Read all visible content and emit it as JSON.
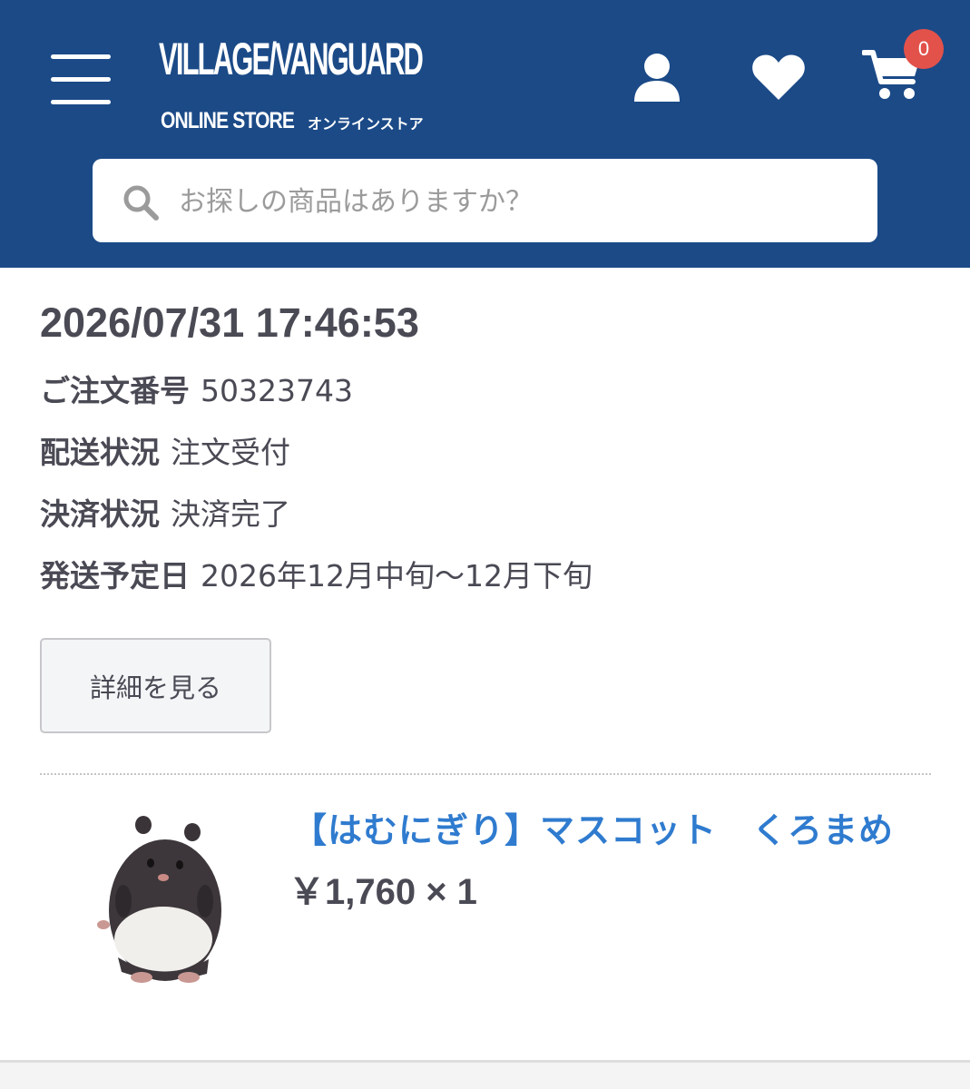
{
  "header": {
    "logo_main": "VILLAGE/VANGUARD",
    "logo_sub_en": "ONLINE STORE",
    "logo_sub_jp": "オンラインストア",
    "cart_count": "0",
    "colors": {
      "header_bg": "#1b4a87",
      "badge": "#e2524a"
    }
  },
  "search": {
    "placeholder": "お探しの商品はありますか？"
  },
  "order": {
    "datetime": "2026/07/31 17:46:53",
    "number_label": "ご注文番号",
    "number_value": "50323743",
    "shipping_status_label": "配送状況",
    "shipping_status_value": "注文受付",
    "payment_status_label": "決済状況",
    "payment_status_value": "決済完了",
    "ship_date_label": "発送予定日",
    "ship_date_value": "2026年12月中旬〜12月下旬",
    "detail_button": "詳細を見る"
  },
  "product": {
    "title": "【はむにぎり】マスコット　くろまめ",
    "price": "￥1,760 × 1",
    "image_icon": "hamster-plush-image",
    "link_color": "#2f7bcf"
  }
}
